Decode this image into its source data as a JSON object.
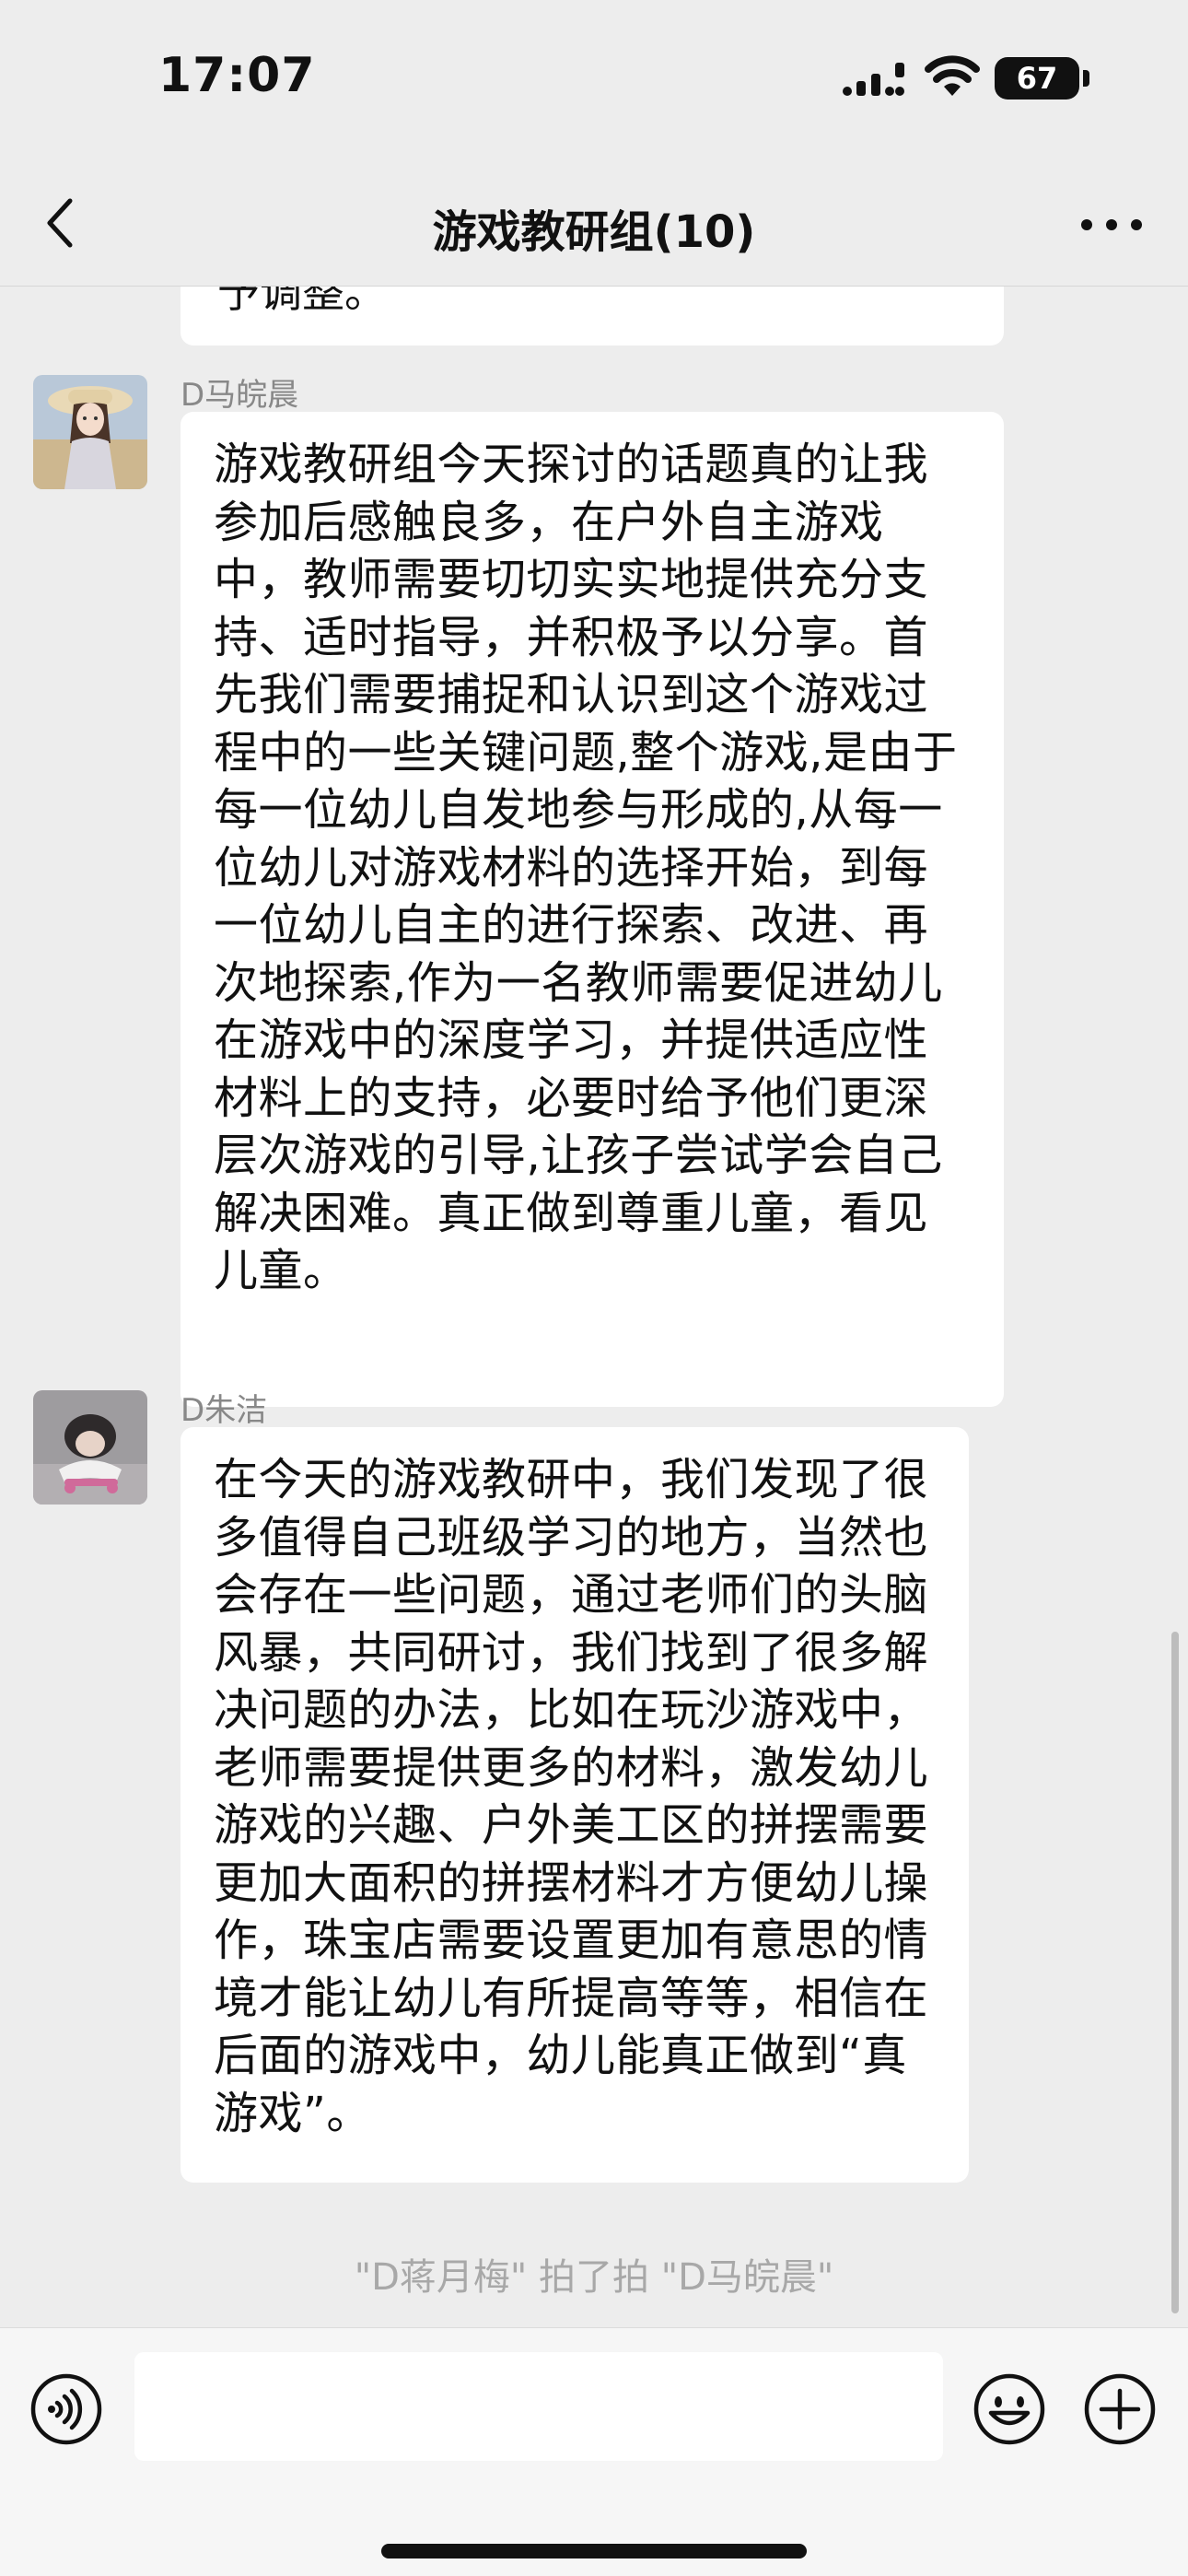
{
  "status_bar": {
    "time": "17:07",
    "battery": "67",
    "signal_icon": "cellular-signal-icon",
    "wifi_icon": "wifi-icon"
  },
  "nav": {
    "title": "游戏教研组(10)",
    "back_icon": "chevron-left-icon",
    "more_icon": "more-dots-icon"
  },
  "chat": {
    "previous_fragment": "予调整。",
    "messages": [
      {
        "sender": "D马皖晨",
        "text": "游戏教研组今天探讨的话题真的让我参加后感触良多，在户外自主游戏中，教师需要切切实实地提供充分支持、适时指导，并积极予以分享。首先我们需要捕捉和认识到这个游戏过程中的一些关键问题,整个游戏,是由于每一位幼儿自发地参与形成的,从每一位幼儿对游戏材料的选择开始，到每一位幼儿自主的进行探索、改进、再次地探索,作为一名教师需要促进幼儿在游戏中的深度学习，并提供适应性材料上的支持，必要时给予他们更深层次游戏的引导,让孩子尝试学会自己解决困难。真正做到尊重儿童，看见儿童。"
      },
      {
        "sender": "D朱洁",
        "text": "在今天的游戏教研中，我们发现了很多值得自己班级学习的地方，当然也会存在一些问题，通过老师们的头脑风暴，共同研讨，我们找到了很多解决问题的办法，比如在玩沙游戏中，老师需要提供更多的材料，激发幼儿游戏的兴趣、户外美工区的拼摆需要更加大面积的拼摆材料才方便幼儿操作，珠宝店需要设置更加有意思的情境才能让幼儿有所提高等等，相信在后面的游戏中，幼儿能真正做到“真游戏”。"
      }
    ],
    "pat_notice": "\"D蒋月梅\" 拍了拍 \"D马皖晨\""
  },
  "input_bar": {
    "voice_icon": "voice-input-icon",
    "input_value": "",
    "emoji_icon": "emoji-smile-icon",
    "add_icon": "plus-circle-icon"
  },
  "colors": {
    "background": "#ededed",
    "bubble": "#ffffff",
    "text": "#111111",
    "sender_name": "#888888",
    "system_text": "#a8a8a8"
  }
}
